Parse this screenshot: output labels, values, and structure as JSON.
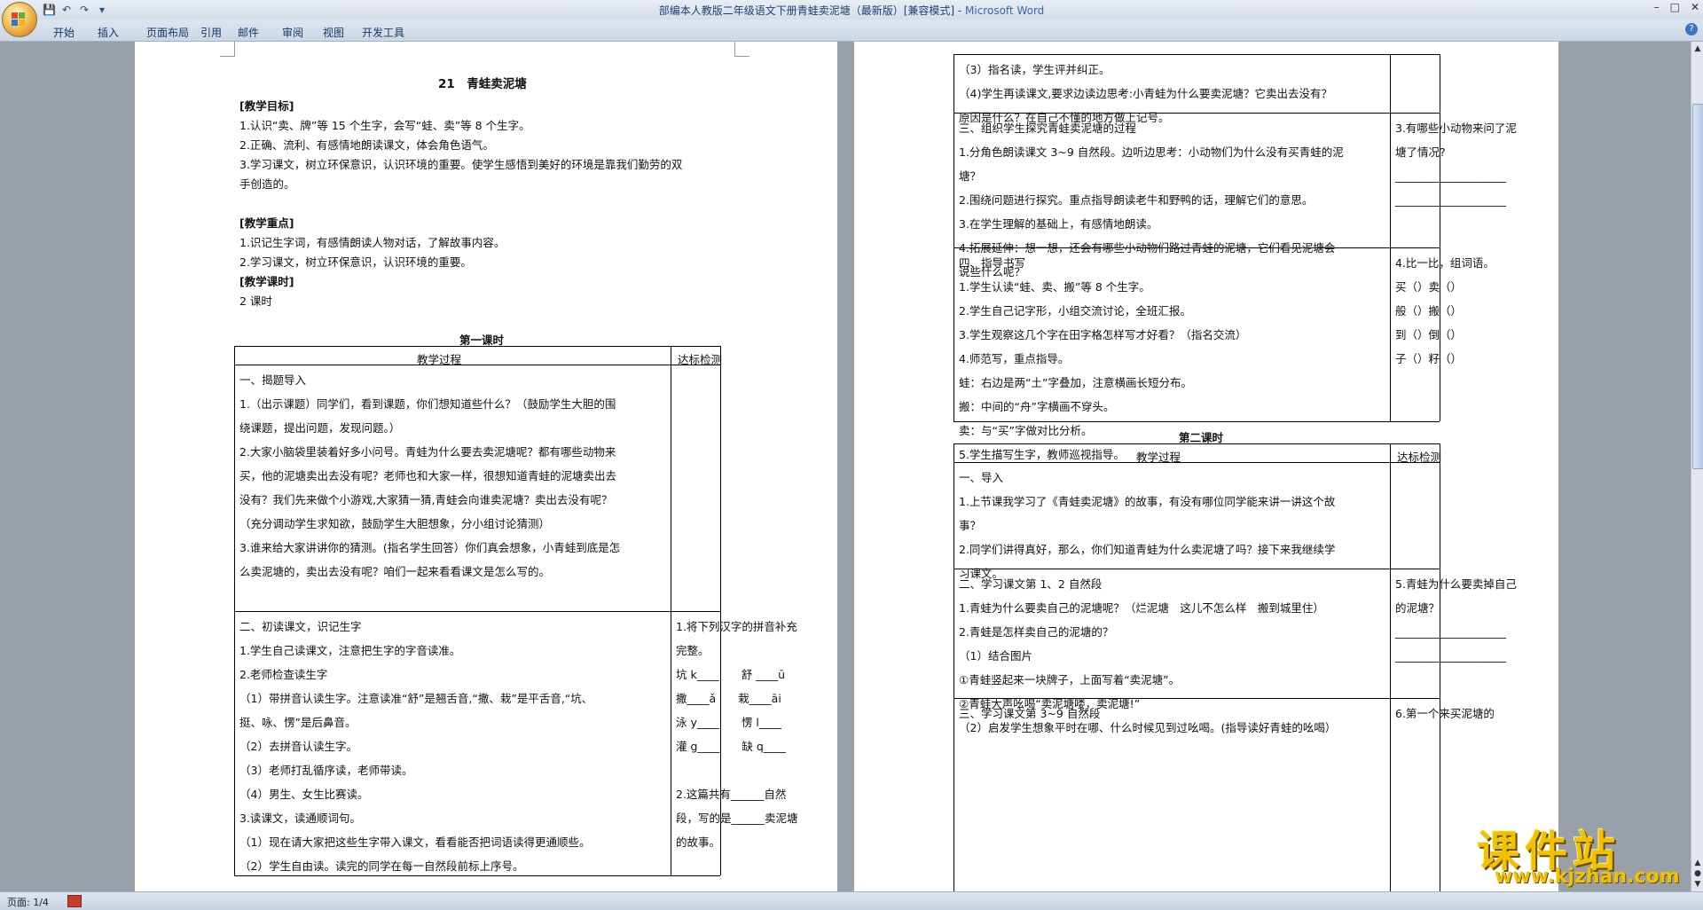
{
  "window": {
    "title": "部编本人教版二年级语文下册青蛙卖泥塘（最新版）[兼容模式] - ",
    "app_name": "Microsoft Word"
  },
  "quick_access": [
    {
      "icon": "save-icon",
      "glyph": "💾"
    },
    {
      "icon": "undo-icon",
      "glyph": "↶"
    },
    {
      "icon": "redo-icon",
      "glyph": "↷"
    },
    {
      "icon": "customize-icon",
      "glyph": "▾"
    }
  ],
  "window_controls": {
    "minimize": "–",
    "maximize": "□",
    "close": "✕"
  },
  "ribbon_tabs": [
    "开始",
    "插入",
    "页面布局",
    "引用",
    "邮件",
    "审阅",
    "视图",
    "开发工具"
  ],
  "status_bar": {
    "page": "页面: 1/4"
  },
  "page1": {
    "title": "21　青蛙卖泥塘",
    "goals_heading": "[教学目标]",
    "goals": [
      "1.认识“卖、牌”等 15 个生字，会写“蛙、卖”等 8 个生字。",
      "2.正确、流利、有感情地朗读课文，体会角色语气。",
      "3.学习课文，树立环保意识，认识环境的重要。使学生感悟到美好的环境是靠我们勤劳的双",
      "手创造的。"
    ],
    "key_heading": "[教学重点]",
    "key_points": [
      "1.识记生字词，有感情朗读人物对话，了解故事内容。",
      "2.学习课文，树立环保意识，认识环境的重要。"
    ],
    "period_heading": "[教学课时]",
    "period": "2 课时",
    "lesson1_heading": "第一课时",
    "table_headers": [
      "教学过程",
      "达标检测"
    ],
    "row1_process": [
      "一、揭题导入",
      "1.（出示课题）同学们，看到课题，你们想知道些什么？（鼓励学生大胆的围",
      "绕课题，提出问题，发现问题。）",
      "2.大家小脑袋里装着好多小问号。青蛙为什么要去卖泥塘呢？都有哪些动物来",
      "买，他的泥塘卖出去没有呢？老师也和大家一样，很想知道青蛙的泥塘卖出去",
      "没有？我们先来做个小游戏,大家猜一猜,青蛙会向谁卖泥塘？卖出去没有呢？",
      "（充分调动学生求知欲，鼓励学生大胆想象，分小组讨论猜测）",
      "3.谁来给大家讲讲你的猜测。(指名学生回答）你们真会想象，小青蛙到底是怎",
      "么卖泥塘的，卖出去没有呢？咱们一起来看看课文是怎么写的。"
    ],
    "row2_process": [
      "二、初读课文，识记生字",
      "1.学生自己读课文，注意把生字的字音读准。",
      "2.老师检查读生字",
      "（1）带拼音认读生字。注意读准“舒”是翘舌音,“撒、栽”是平舌音,“坑、",
      "挺、咏、愣”是后鼻音。",
      "（2）去拼音认读生字。",
      "（3）老师打乱循序读，老师带读。",
      "（4）男生、女生比赛读。",
      "3.读课文，读通顺词句。",
      "（1）现在请大家把这些生字带入课文，看看能否把词语读得更通顺些。",
      "（2）学生自由读。读完的同学在每一自然段前标上序号。"
    ],
    "row2_check": [
      "1.将下列汉字的拼音补充",
      "完整。",
      "坑 k____　　舒 ____ū",
      "撒____ǎ　　栽____āi",
      "泳 y____　　愣 l____",
      "灌 g____　　缺 q____",
      "",
      "2.这篇共有______自然",
      "段，写的是______卖泥塘",
      "的故事。"
    ]
  },
  "page2": {
    "row_a_process": [
      "（3）指名读，学生评并纠正。",
      "（4)学生再读课文,要求边读边思考:小青蛙为什么要卖泥塘？它卖出去没有？",
      "原因是什么？在自己不懂的地方做上记号。"
    ],
    "row_b_process": [
      "三、组织学生探究青蛙卖泥塘的过程",
      "1.分角色朗读课文 3~9 自然段。边听边思考：小动物们为什么没有买青蛙的泥",
      "塘？",
      "2.围绕问题进行探究。重点指导朗读老牛和野鸭的话，理解它们的意思。",
      "3.在学生理解的基础上，有感情地朗读。",
      "4.拓展延伸：想一想，还会有哪些小动物们路过青蛙的泥塘，它们看见泥塘会",
      "说些什么呢？"
    ],
    "row_b_check": [
      "3.有哪些小动物来问了泥",
      "塘了情况?",
      "____________________",
      "____________________"
    ],
    "row_c_process": [
      "四、指导书写",
      "1.学生认读“蛙、卖、搬”等 8 个生字。",
      "2.学生自己记字形，小组交流讨论，全班汇报。",
      "3.学生观察这几个字在田字格怎样写才好看？（指名交流）",
      "4.师范写，重点指导。",
      "蛙：右边是两“土”字叠加，注意横画长短分布。",
      "搬：中间的“舟”字横画不穿头。",
      "卖：与“买”字做对比分析。",
      "5.学生描写生字，教师巡视指导。"
    ],
    "row_c_check": [
      "4.比一比，组词语。",
      "买（）卖（）",
      "般（）搬（）",
      "到（）倒（）",
      "子（）籽（）"
    ],
    "lesson2_heading": "第二课时",
    "table_headers": [
      "教学过程",
      "达标检测"
    ],
    "row_d_process": [
      "一、导入",
      "1.上节课我学习了《青蛙卖泥塘》的故事，有没有哪位同学能来讲一讲这个故",
      "事？",
      "2.同学们讲得真好，那么，你们知道青蛙为什么卖泥塘了吗？接下来我继续学",
      "习课文。"
    ],
    "row_e_process": [
      "二、学习课文第 1、2 自然段",
      "1.青蛙为什么要卖自己的泥塘呢？（烂泥塘　这儿不怎么样　搬到城里住）",
      "2.青蛙是怎样卖自己的泥塘的？",
      "（1）结合图片",
      "①青蛙竖起来一块牌子，上面写着“卖泥塘”。",
      "②青蛙大声吆喝“卖泥塘喽，卖泥塘!”",
      "（2）启发学生想象平时在哪、什么时候见到过吆喝。(指导读好青蛙的吆喝）"
    ],
    "row_e_check": [
      "5.青蛙为什么要卖掉自己",
      "的泥塘？",
      "____________________",
      "____________________"
    ],
    "row_f_process": [
      "三、学习课文第 3~9 自然段"
    ],
    "row_f_check": [
      "6.第一个来买泥塘的"
    ]
  },
  "watermark": {
    "text": "课件站",
    "url": "www.kjzhan.com"
  }
}
